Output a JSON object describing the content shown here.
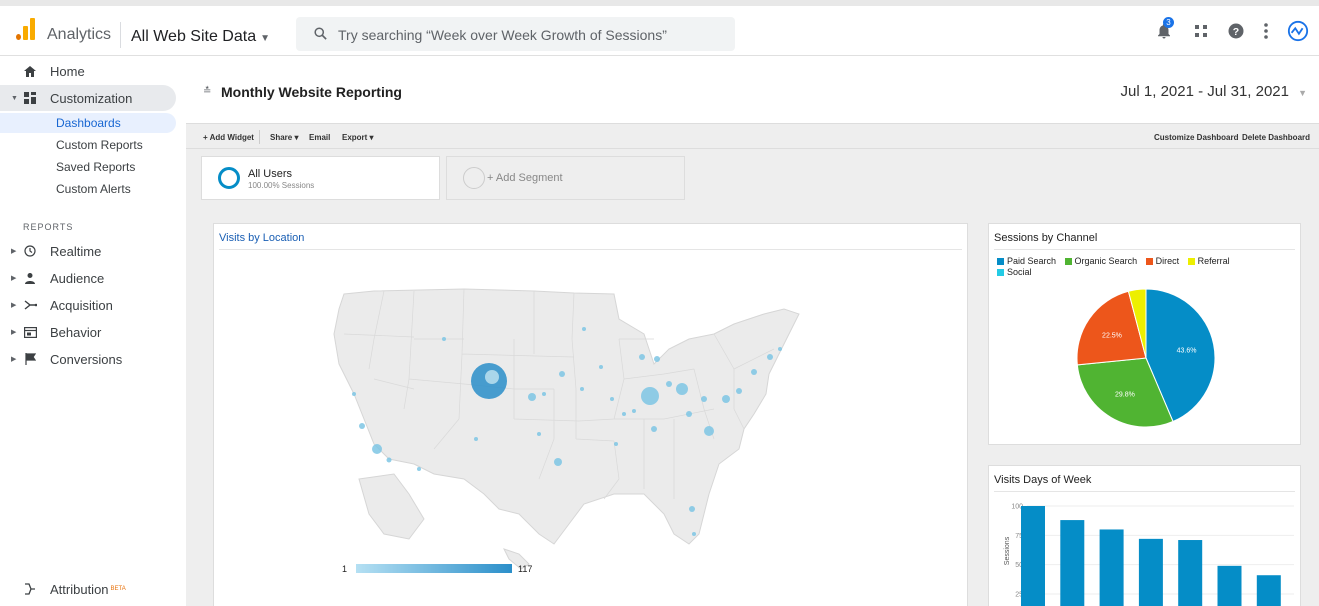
{
  "app": {
    "title": "Analytics",
    "property": "All Web Site Data",
    "search_placeholder": "Try searching “Week over Week Growth of Sessions”",
    "notification_count": "3",
    "colors": {
      "accent": "#1a73e8",
      "logo_orange": "#f9ab00",
      "logo_dark": "#e37400"
    }
  },
  "sidebar": {
    "home": "Home",
    "customization": "Customization",
    "customization_items": [
      "Dashboards",
      "Custom Reports",
      "Saved Reports",
      "Custom Alerts"
    ],
    "reports_label": "REPORTS",
    "reports": [
      {
        "label": "Realtime",
        "icon": "clock-icon"
      },
      {
        "label": "Audience",
        "icon": "person-icon"
      },
      {
        "label": "Acquisition",
        "icon": "acquisition-icon"
      },
      {
        "label": "Behavior",
        "icon": "behavior-icon"
      },
      {
        "label": "Conversions",
        "icon": "flag-icon"
      }
    ],
    "attribution": "Attribution",
    "attribution_badge": "BETA"
  },
  "dashboard": {
    "title": "Monthly Website Reporting",
    "date_range": "Jul 1, 2021 - Jul 31, 2021",
    "actions": {
      "add_widget": "+ Add Widget",
      "share": "Share ▾",
      "email": "Email",
      "export": "Export ▾",
      "customize": "Customize Dashboard",
      "delete": "Delete Dashboard"
    },
    "segments": {
      "active_name": "All Users",
      "active_sub": "100.00% Sessions",
      "add": "+ Add Segment"
    }
  },
  "widgets": {
    "visits_location": {
      "title": "Visits by Location",
      "scale_min": "1",
      "scale_max": "117"
    },
    "sessions_channel": {
      "title": "Sessions by Channel",
      "legend": [
        {
          "name": "Paid Search",
          "color": "#058dc7"
        },
        {
          "name": "Organic Search",
          "color": "#50b432"
        },
        {
          "name": "Direct",
          "color": "#ed561b"
        },
        {
          "name": "Referral",
          "color": "#edef00"
        },
        {
          "name": "Social",
          "color": "#24cbe5"
        }
      ]
    },
    "visits_days": {
      "title": "Visits Days of Week",
      "ylabel": "Sessions"
    }
  },
  "chart_data": [
    {
      "type": "pie",
      "title": "Sessions by Channel",
      "categories": [
        "Paid Search",
        "Organic Search",
        "Direct",
        "Referral",
        "Social"
      ],
      "values": [
        43.6,
        29.8,
        22.5,
        4.1,
        0
      ],
      "labels": [
        "43.6%",
        "29.8%",
        "22.5%",
        "",
        ""
      ],
      "colors": [
        "#058dc7",
        "#50b432",
        "#ed561b",
        "#edef00",
        "#24cbe5"
      ]
    },
    {
      "type": "bar",
      "title": "Visits Days of Week",
      "ylabel": "Sessions",
      "yticks": [
        "100",
        "75",
        "50",
        "25"
      ],
      "ylim": [
        25,
        100
      ],
      "values": [
        100,
        88,
        80,
        72,
        71,
        49,
        41
      ],
      "color": "#058dc7"
    }
  ]
}
